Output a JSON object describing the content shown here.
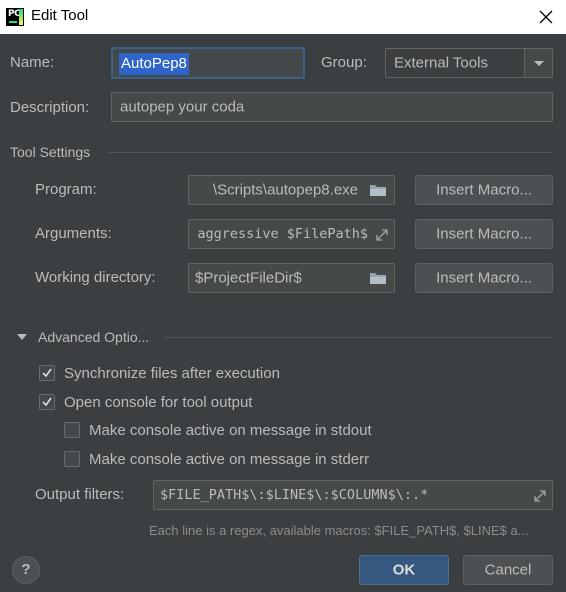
{
  "window": {
    "title": "Edit Tool"
  },
  "name": {
    "label": "Name:",
    "value": "AutoPep8"
  },
  "group": {
    "label": "Group:",
    "value": "External Tools"
  },
  "description": {
    "label": "Description:",
    "value": "autopep your coda"
  },
  "tool_settings": {
    "header": "Tool Settings",
    "program": {
      "label": "Program:",
      "value": "\\Scripts\\autopep8.exe"
    },
    "arguments": {
      "label": "Arguments:",
      "value": "aggressive $FilePath$"
    },
    "working_directory": {
      "label": "Working directory:",
      "value": "$ProjectFileDir$"
    },
    "insert_macro_label": "Insert Macro..."
  },
  "advanced": {
    "header": "Advanced Optio...",
    "expanded": true,
    "options": [
      {
        "label": "Synchronize files after execution",
        "checked": true
      },
      {
        "label": "Open console for tool output",
        "checked": true
      },
      {
        "label": "Make console active on message in stdout",
        "checked": false
      },
      {
        "label": "Make console active on message in stderr",
        "checked": false
      }
    ],
    "output_filters": {
      "label": "Output filters:",
      "value": "$FILE_PATH$\\:$LINE$\\:$COLUMN$\\:.*"
    },
    "hint": "Each line is a regex, available macros: $FILE_PATH$, $LINE$ a..."
  },
  "footer": {
    "help_label": "?",
    "ok_label": "OK",
    "cancel_label": "Cancel"
  },
  "colors": {
    "background": "#3c3f41",
    "field": "#45494a",
    "focus": "#3d6185",
    "selection": "#2f65ca",
    "primary_button": "#365880"
  }
}
